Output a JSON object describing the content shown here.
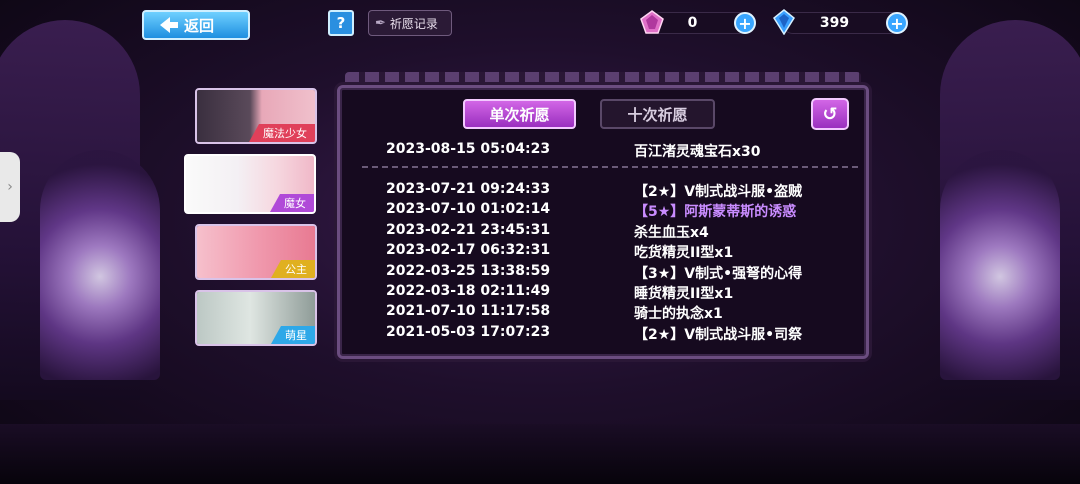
{
  "topbar": {
    "back_label": "返回",
    "help_label": "?",
    "record_label": "祈愿记录",
    "currency_gem_value": "0",
    "currency_crystal_value": "399"
  },
  "side_cards": [
    {
      "label": "魔法少女",
      "color": "#e0405a"
    },
    {
      "label": "魔女",
      "color": "#b04ad8"
    },
    {
      "label": "公主",
      "color": "#e0b020"
    },
    {
      "label": "萌星",
      "color": "#2ea8e8"
    }
  ],
  "panel": {
    "tab_single": "单次祈愿",
    "tab_ten": "十次祈愿",
    "return_icon": "↺",
    "top_record": {
      "time": "2023-08-15 05:04:23",
      "item": "百江渚灵魂宝石x30"
    },
    "records": [
      {
        "time": "2023-07-21 09:24:33",
        "item": "【2★】V制式战斗服•盗贼",
        "rare": false
      },
      {
        "time": "2023-07-10 01:02:14",
        "item": "【5★】阿斯蒙蒂斯的诱惑",
        "rare": true
      },
      {
        "time": "2023-02-21 23:45:31",
        "item": "杀生血玉x4",
        "rare": false
      },
      {
        "time": "2023-02-17 06:32:31",
        "item": "吃货精灵II型x1",
        "rare": false
      },
      {
        "time": "2022-03-25 13:38:59",
        "item": "【3★】V制式•强弩的心得",
        "rare": false
      },
      {
        "time": "2022-03-18 02:11:49",
        "item": "睡货精灵II型x1",
        "rare": false
      },
      {
        "time": "2021-07-10 11:17:58",
        "item": "骑士的执念x1",
        "rare": false
      },
      {
        "time": "2021-05-03 17:07:23",
        "item": "【2★】V制式战斗服•司祭",
        "rare": false
      }
    ]
  },
  "side_handle_icon": "›"
}
